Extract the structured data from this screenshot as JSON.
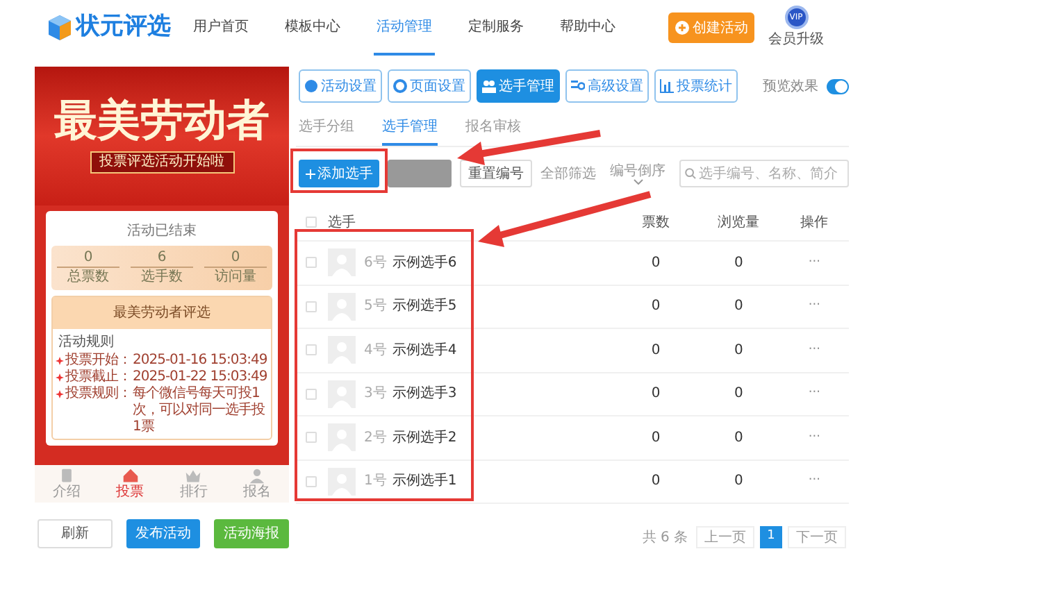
{
  "header": {
    "logo": "状元评选",
    "nav": [
      {
        "label": "用户首页",
        "selected": false
      },
      {
        "label": "模板中心",
        "selected": false
      },
      {
        "label": "活动管理",
        "selected": true
      },
      {
        "label": "定制服务",
        "selected": false
      },
      {
        "label": "帮助中心",
        "selected": false
      }
    ],
    "create_button": "创建活动",
    "vip": {
      "badge": "VIP",
      "label": "会员升级"
    }
  },
  "preview": {
    "banner": {
      "title": "最美劳动者",
      "subtitle": "投票评选活动开始啦"
    },
    "status": "活动已结束",
    "stats": [
      {
        "value": "0",
        "label": "总票数"
      },
      {
        "value": "6",
        "label": "选手数"
      },
      {
        "value": "0",
        "label": "访问量"
      }
    ],
    "card_title": "最美劳动者评选",
    "rules_title": "活动规则",
    "rules": [
      {
        "label": "投票开始：",
        "value": "2025-01-16 15:03:49"
      },
      {
        "label": "投票截止：",
        "value": "2025-01-22 15:03:49"
      },
      {
        "label": "投票规则：",
        "value": "每个微信号每天可投1次，可以对同一选手投1票"
      }
    ],
    "bottom_nav": [
      {
        "label": "介绍",
        "selected": false,
        "kind": "doc"
      },
      {
        "label": "投票",
        "selected": true,
        "kind": "home"
      },
      {
        "label": "排行",
        "selected": false,
        "kind": "crown"
      },
      {
        "label": "报名",
        "selected": false,
        "kind": "user"
      }
    ]
  },
  "actions": [
    {
      "label": "刷新",
      "kind": "plain"
    },
    {
      "label": "发布活动",
      "kind": "primary"
    },
    {
      "label": "活动海报",
      "kind": "success"
    }
  ],
  "tool_tabs": [
    {
      "label": "活动设置",
      "selected": false
    },
    {
      "label": "页面设置",
      "selected": false
    },
    {
      "label": "选手管理",
      "selected": true
    },
    {
      "label": "高级设置",
      "selected": false
    },
    {
      "label": "投票统计",
      "selected": false
    }
  ],
  "preview_toggle": {
    "label": "预览效果",
    "on": true
  },
  "sub_tabs": [
    {
      "label": "选手分组",
      "selected": false
    },
    {
      "label": "选手管理",
      "selected": true
    },
    {
      "label": "报名审核",
      "selected": false
    }
  ],
  "toolbar": {
    "add_button": "添加选手",
    "reset_button": "重置编号",
    "filter": "全部筛选",
    "sort": "编号倒序",
    "search_placeholder": "选手编号、名称、简介"
  },
  "table": {
    "all_checked": false,
    "columns": [
      "选手",
      "票数",
      "浏览量",
      "操作"
    ],
    "rows": [
      {
        "number": "6号",
        "name": "示例选手6",
        "votes": "0",
        "views": "0",
        "action": "···",
        "checked": false
      },
      {
        "number": "5号",
        "name": "示例选手5",
        "votes": "0",
        "views": "0",
        "action": "···",
        "checked": false
      },
      {
        "number": "4号",
        "name": "示例选手4",
        "votes": "0",
        "views": "0",
        "action": "···",
        "checked": false
      },
      {
        "number": "3号",
        "name": "示例选手3",
        "votes": "0",
        "views": "0",
        "action": "···",
        "checked": false
      },
      {
        "number": "2号",
        "name": "示例选手2",
        "votes": "0",
        "views": "0",
        "action": "···",
        "checked": false
      },
      {
        "number": "1号",
        "name": "示例选手1",
        "votes": "0",
        "views": "0",
        "action": "···",
        "checked": false
      }
    ]
  },
  "pagination": {
    "total": "共 6 条",
    "prev": "上一页",
    "pages": [
      {
        "label": "1",
        "selected": true
      }
    ],
    "next": "下一页"
  }
}
